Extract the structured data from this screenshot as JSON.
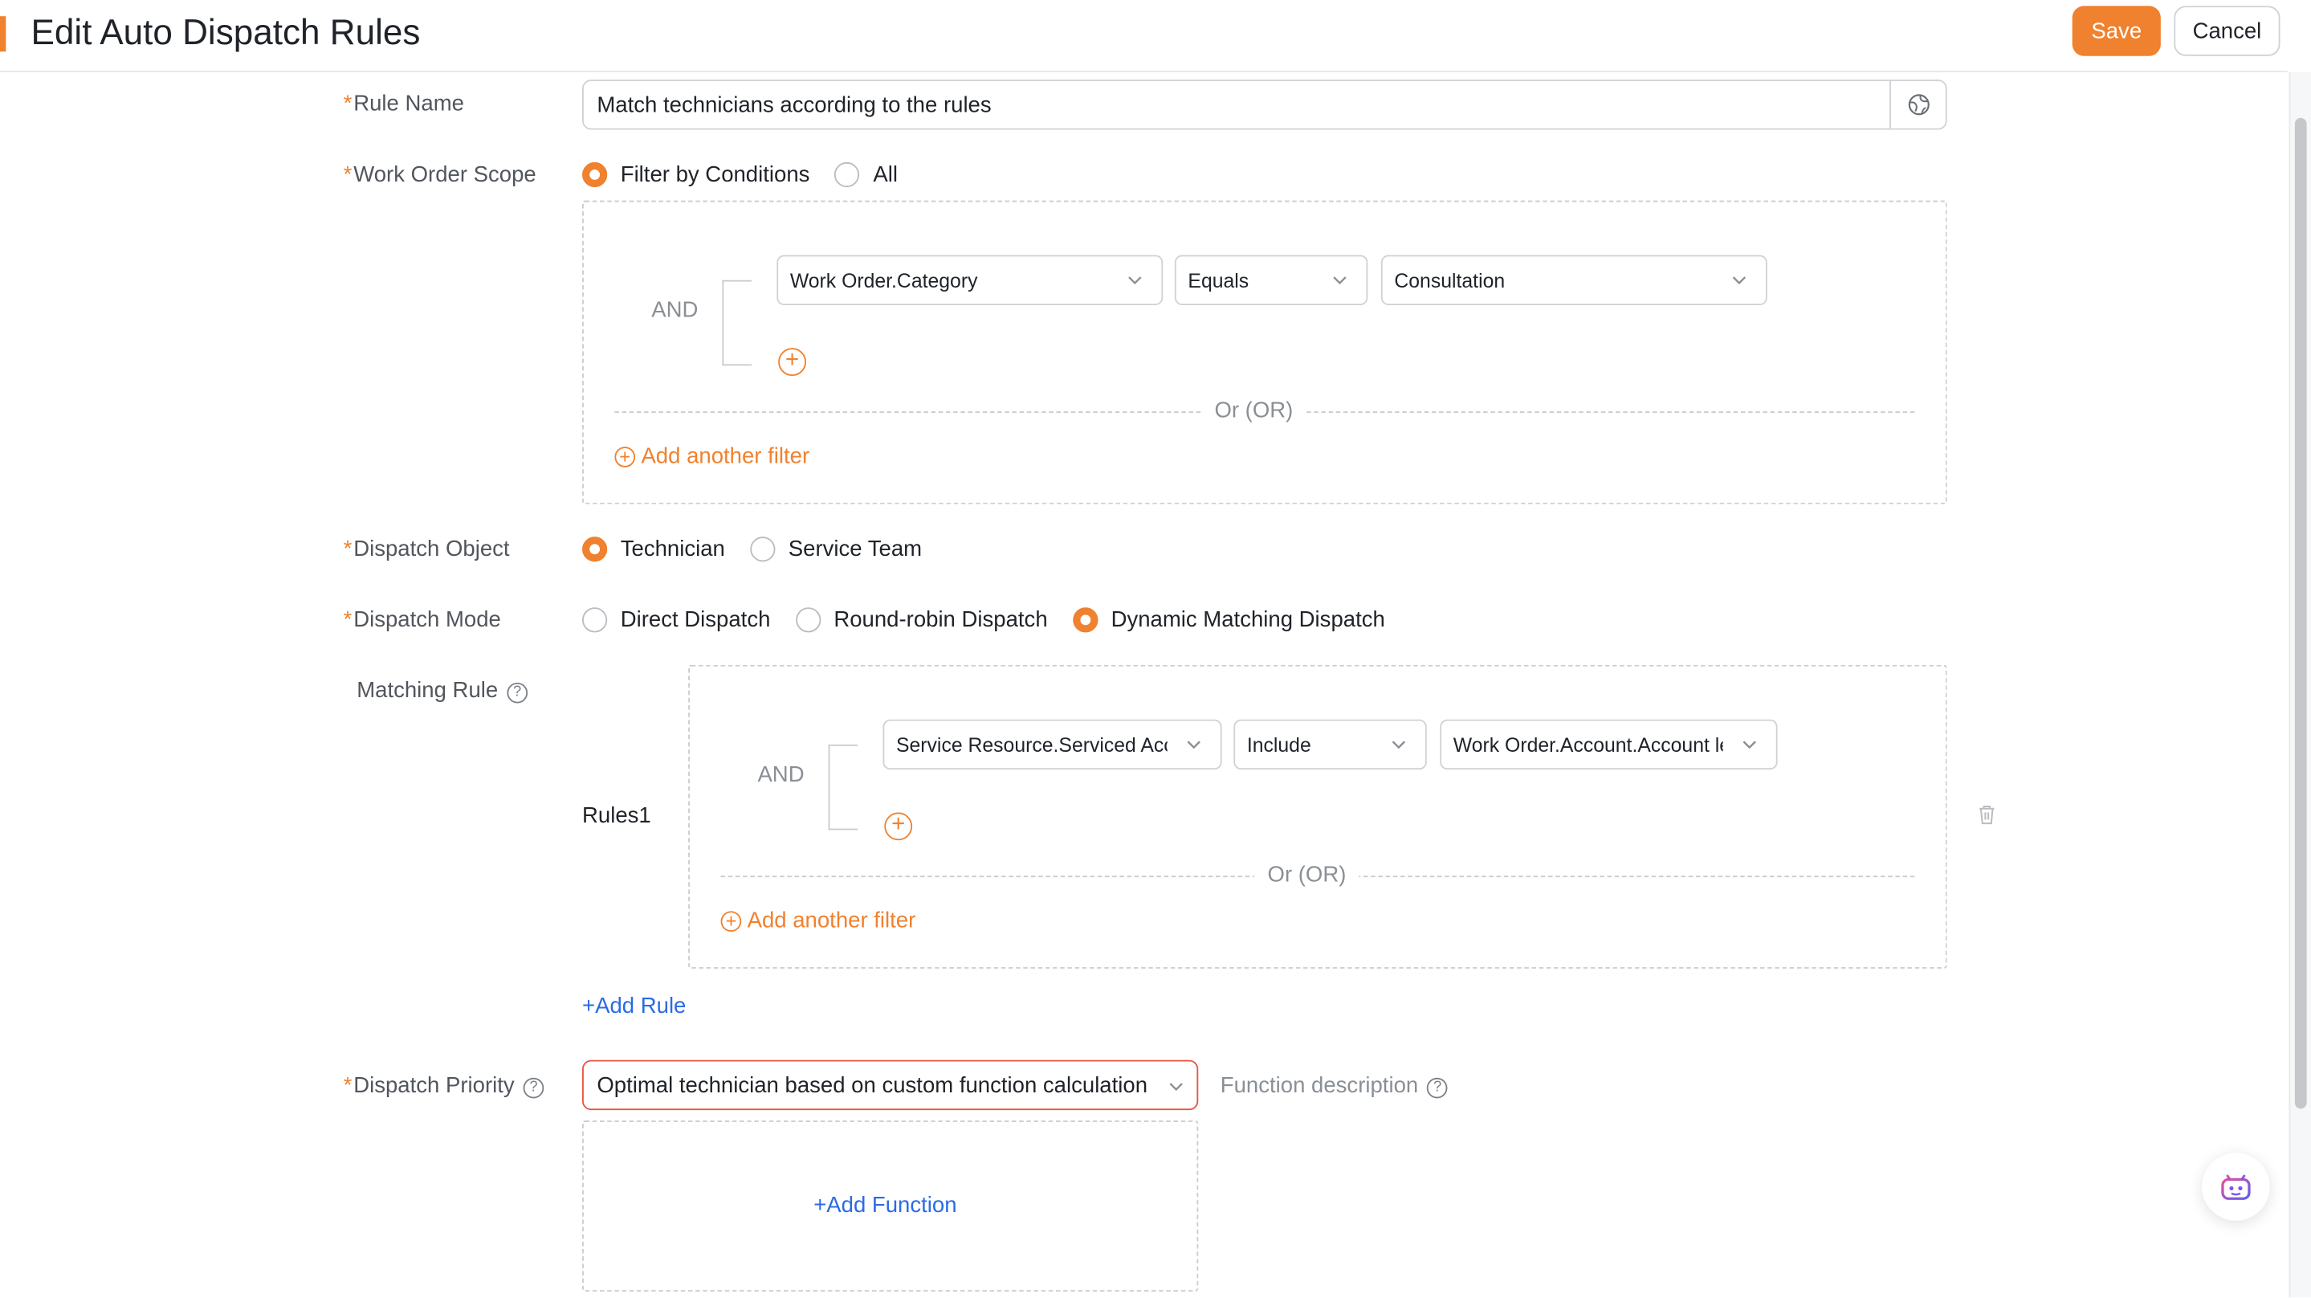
{
  "header": {
    "title": "Edit Auto Dispatch Rules",
    "save_label": "Save",
    "cancel_label": "Cancel"
  },
  "form": {
    "rule_name": {
      "label": "Rule Name",
      "value": "Match technicians according to the rules",
      "addon_icon": "globe-icon"
    },
    "work_order_scope": {
      "label": "Work Order Scope",
      "options": [
        "Filter by Conditions",
        "All"
      ],
      "selected": "Filter by Conditions",
      "filter": {
        "logic": "AND",
        "condition": {
          "field": "Work Order.Category",
          "operator": "Equals",
          "value": "Consultation"
        },
        "or_label": "Or (OR)",
        "add_filter_label": "Add another filter"
      }
    },
    "dispatch_object": {
      "label": "Dispatch Object",
      "options": [
        "Technician",
        "Service Team"
      ],
      "selected": "Technician"
    },
    "dispatch_mode": {
      "label": "Dispatch Mode",
      "options": [
        "Direct Dispatch",
        "Round-robin Dispatch",
        "Dynamic Matching Dispatch"
      ],
      "selected": "Dynamic Matching Dispatch"
    },
    "matching_rule": {
      "label": "Matching Rule",
      "rules": [
        {
          "name": "Rules1",
          "logic": "AND",
          "condition": {
            "field": "Service Resource.Serviced Acco",
            "operator": "Include",
            "value": "Work Order.Account.Account lev"
          },
          "or_label": "Or (OR)",
          "add_filter_label": "Add another filter"
        }
      ],
      "add_rule_label": "Add Rule"
    },
    "dispatch_priority": {
      "label": "Dispatch Priority",
      "value": "Optimal technician based on custom function calculation",
      "function_description_label": "Function description",
      "add_function_label": "Add Function"
    }
  },
  "colors": {
    "accent": "#f0812e",
    "link": "#2a6be6",
    "error_border": "#e8543f"
  }
}
